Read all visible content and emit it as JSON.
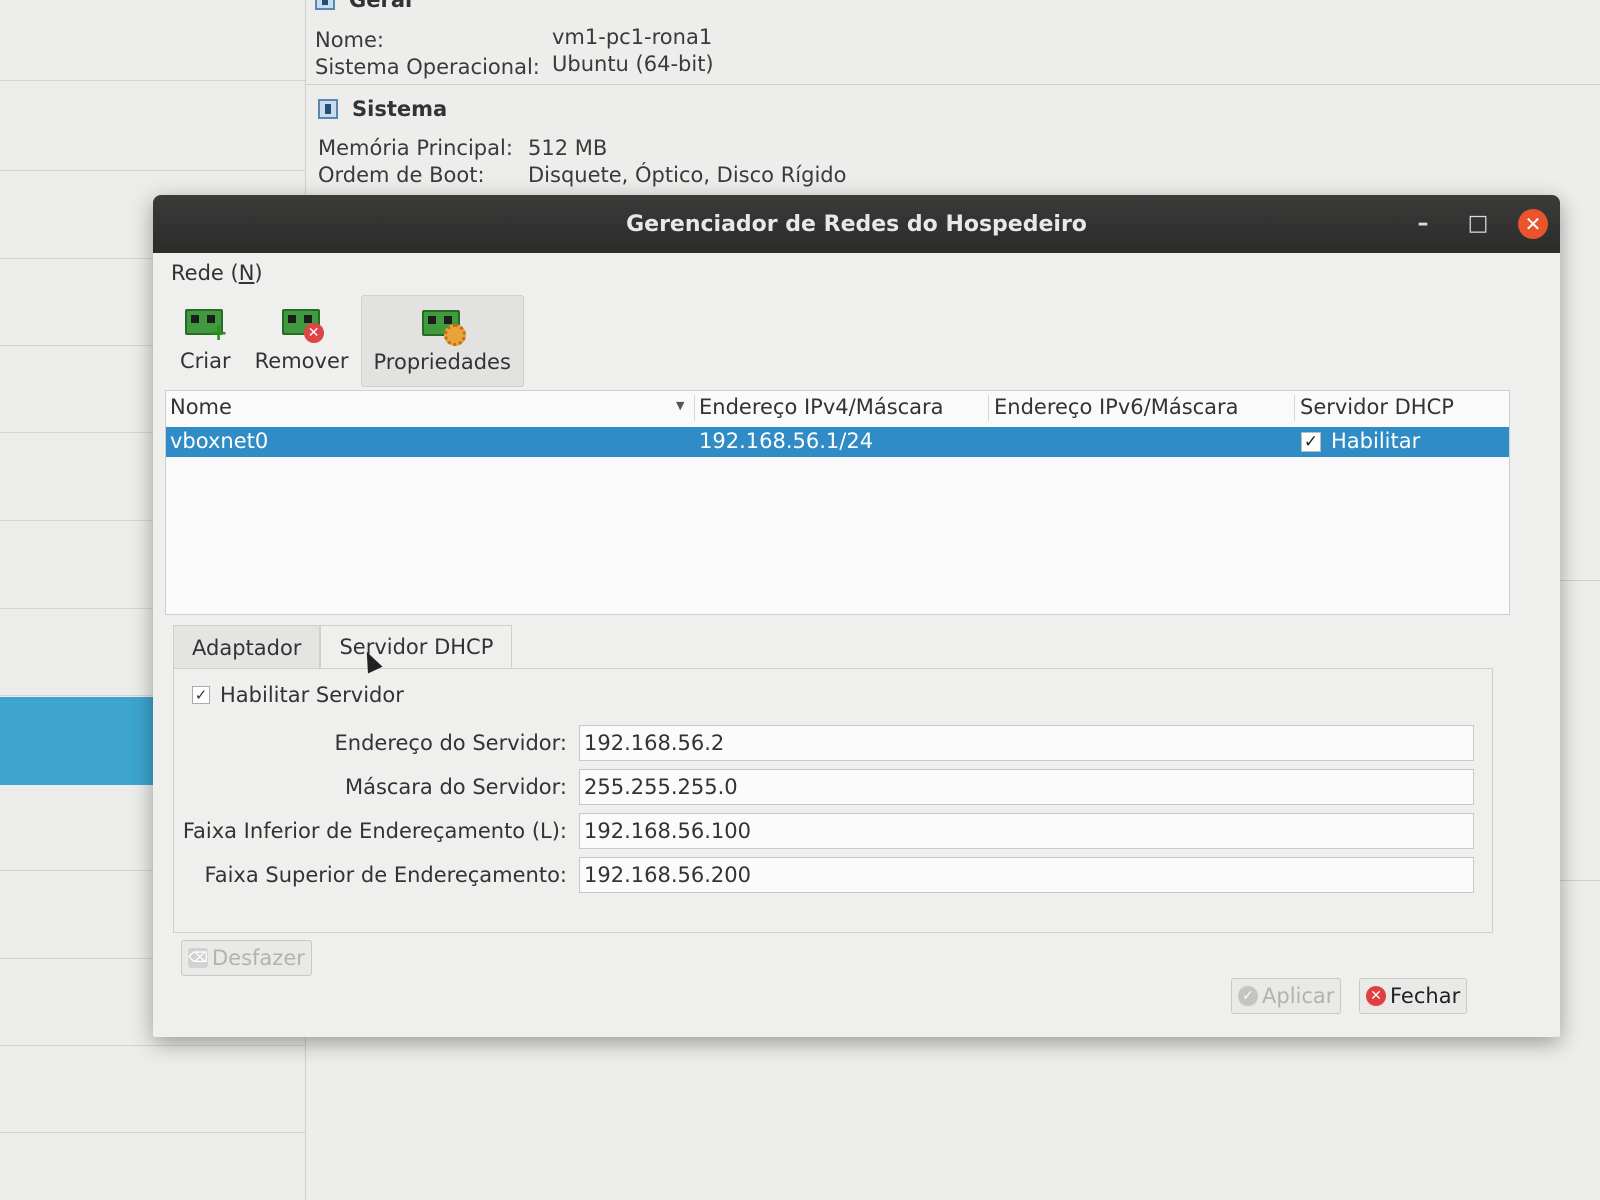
{
  "background": {
    "geral_heading": "Geral",
    "geral": [
      {
        "label": "Nome:",
        "value": "vm1-pc1-rona1"
      },
      {
        "label": "Sistema Operacional:",
        "value": "Ubuntu (64-bit)"
      }
    ],
    "sistema_heading": "Sistema",
    "sistema": [
      {
        "label": "Memória Principal:",
        "value": "512 MB"
      },
      {
        "label": "Ordem de Boot:",
        "value": "Disquete, Óptico, Disco Rígido"
      }
    ]
  },
  "dialog": {
    "title": "Gerenciador de Redes do Hospedeiro",
    "window_buttons": {
      "minimize": "–",
      "maximize": "□",
      "close": "✕"
    },
    "menu": {
      "rede_prefix": "Rede (",
      "rede_mnemonic": "N",
      "rede_suffix": ")"
    },
    "toolbar": [
      {
        "label": "Criar",
        "icon": "network-card-add-icon"
      },
      {
        "label": "Remover",
        "icon": "network-card-remove-icon"
      },
      {
        "label": "Propriedades",
        "icon": "network-card-properties-icon"
      }
    ],
    "table": {
      "headers": [
        "Nome",
        "Endereço IPv4/Máscara",
        "Endereço IPv6/Máscara",
        "Servidor DHCP"
      ],
      "rows": [
        {
          "nome": "vboxnet0",
          "ipv4": "192.168.56.1/24",
          "ipv6": "",
          "dhcp_checked": true,
          "dhcp_label": "Habilitar"
        }
      ]
    },
    "tabs": [
      {
        "label": "Adaptador",
        "active": false
      },
      {
        "label": "Servidor DHCP",
        "active": true
      }
    ],
    "dhcp": {
      "enable_label": "Habilitar Servidor",
      "enable_checked": true,
      "fields": [
        {
          "label": "Endereço do Servidor:",
          "value": "192.168.56.2"
        },
        {
          "label": "Máscara do Servidor:",
          "value": "255.255.255.0"
        },
        {
          "label": "Faixa Inferior de Endereçamento (L):",
          "value": "192.168.56.100"
        },
        {
          "label": "Faixa Superior de Endereçamento:",
          "value": "192.168.56.200"
        }
      ]
    },
    "buttons": {
      "desfazer": "Desfazer",
      "aplicar": "Aplicar",
      "fechar": "Fechar"
    },
    "colors": {
      "selection": "#308cc6",
      "close": "#e9542d",
      "titlebar": "#2f2f2e"
    }
  }
}
